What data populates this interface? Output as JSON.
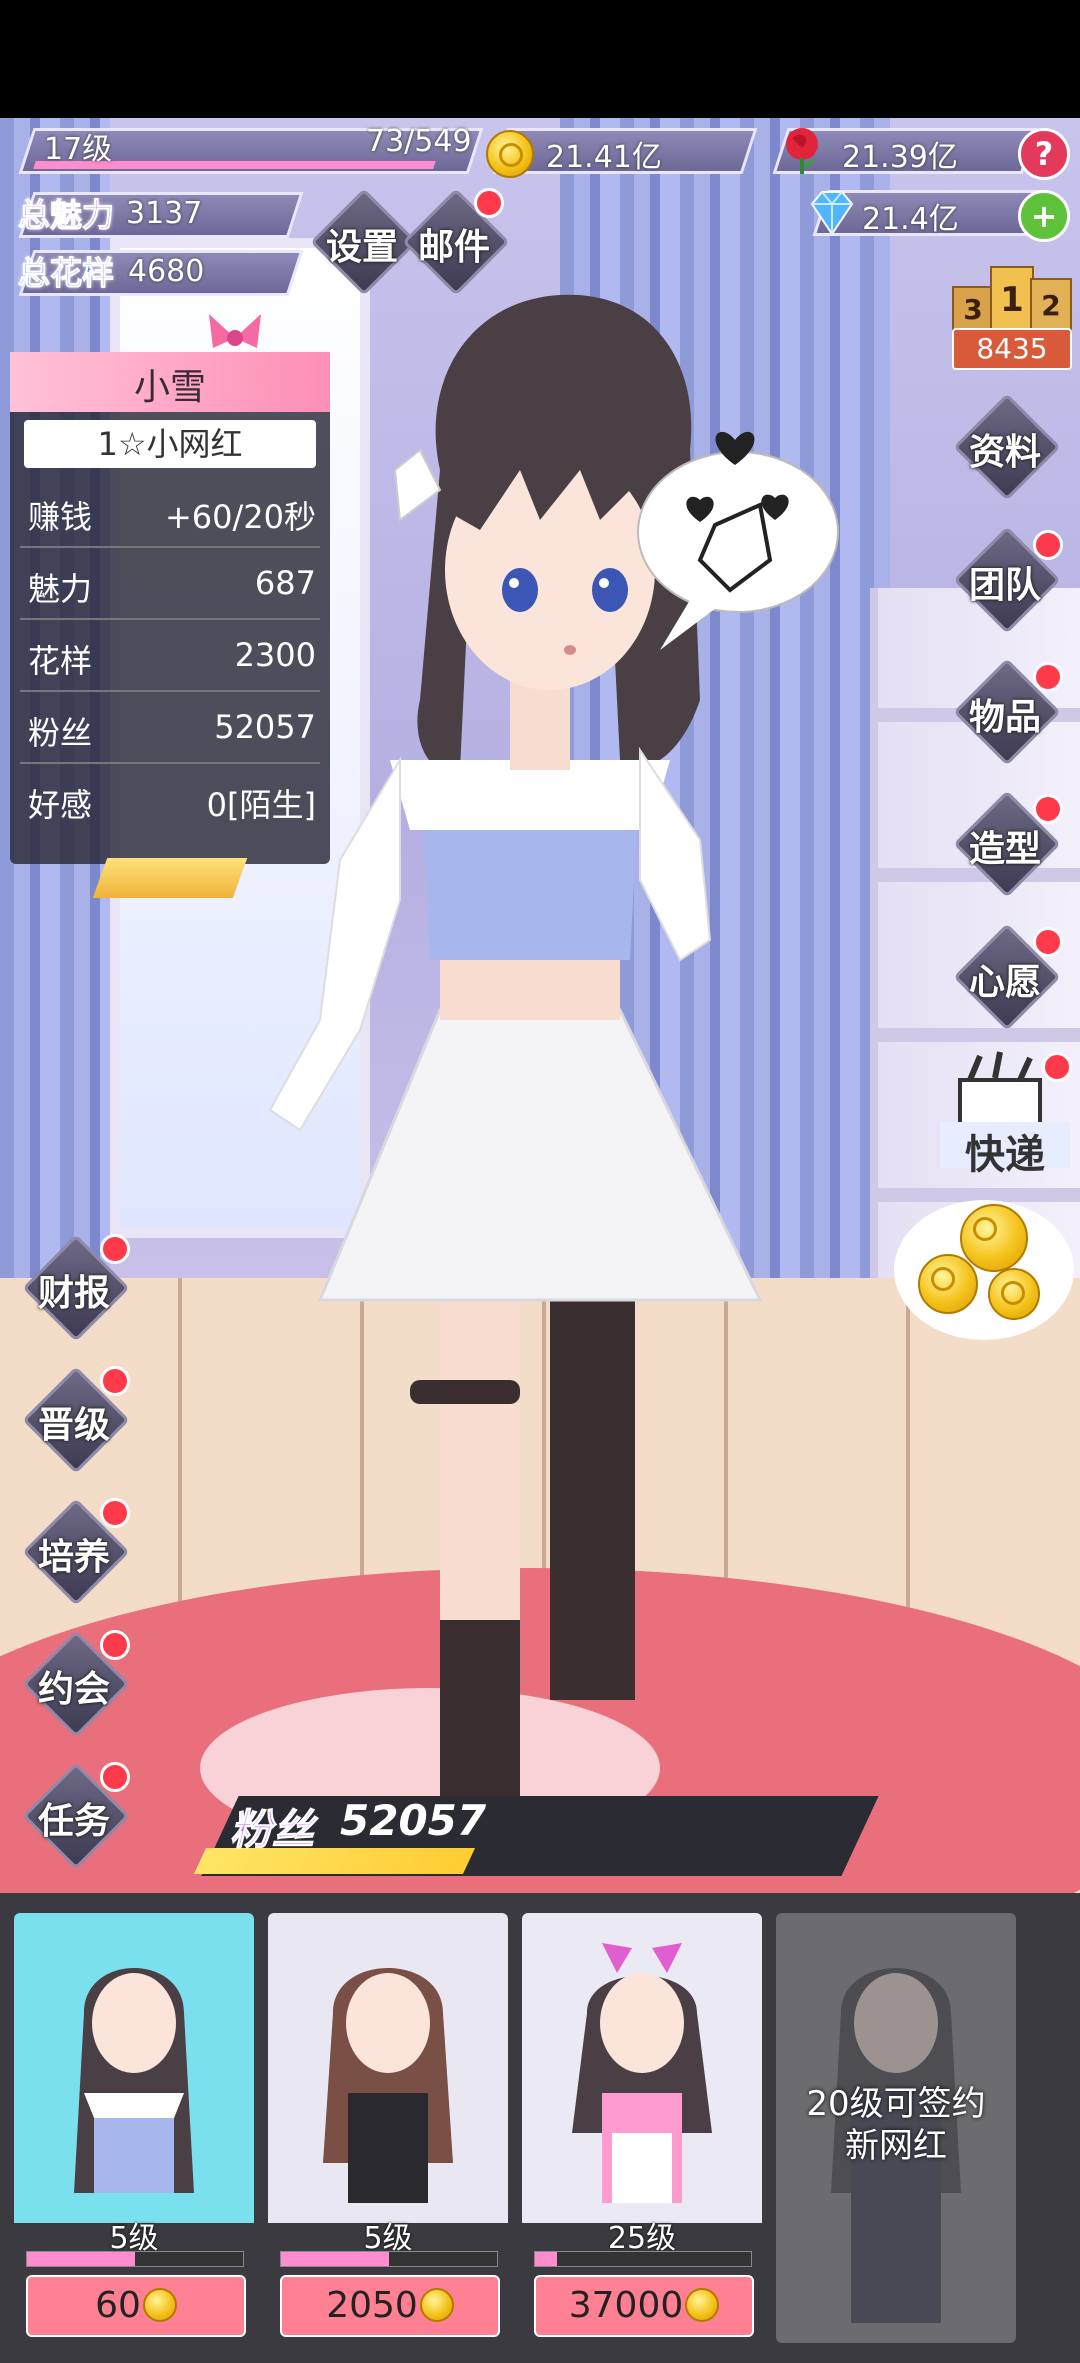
{
  "header": {
    "level": "17级",
    "exp": "73/549",
    "gold": "21.41亿",
    "roses": "21.39亿",
    "diamonds": "21.4亿",
    "help": "?",
    "add": "+"
  },
  "stats": {
    "charm_label": "总魅力",
    "charm_value": "3137",
    "style_label": "总花样",
    "style_value": "4680"
  },
  "top_buttons": {
    "settings": "设置",
    "mail": "邮件"
  },
  "ranking": {
    "podium": [
      "3",
      "1",
      "2"
    ],
    "value": "8435"
  },
  "profile": {
    "name": "小雪",
    "title": "1☆小网红",
    "rows": [
      {
        "key": "赚钱",
        "value": "+60/20秒"
      },
      {
        "key": "魅力",
        "value": "687"
      },
      {
        "key": "花样",
        "value": "2300"
      },
      {
        "key": "粉丝",
        "value": "52057"
      },
      {
        "key": "好感",
        "value": "0[陌生]"
      }
    ]
  },
  "right_menu": [
    "资料",
    "团队",
    "物品",
    "造型",
    "心愿",
    "快递"
  ],
  "left_menu": [
    "财报",
    "晋级",
    "培养",
    "约会",
    "任务"
  ],
  "fans": {
    "label": "粉丝",
    "value": "52057",
    "progress": 0.42
  },
  "cards": [
    {
      "level": "5级",
      "price": "60",
      "progress": 0.5,
      "bg": "#7be0ee"
    },
    {
      "level": "5级",
      "price": "2050",
      "progress": 0.5,
      "bg": "#e9e7f2"
    },
    {
      "level": "25级",
      "price": "37000",
      "progress": 0.1,
      "bg": "#ebe9f3"
    },
    {
      "lock_text_1": "20级可签约",
      "lock_text_2": "新网红",
      "bg": "#6b6b70"
    }
  ],
  "colors": {
    "accent": "#ff7f93",
    "alert": "#ff3b4b",
    "charm": "#b96cff",
    "style": "#4a8dff"
  }
}
